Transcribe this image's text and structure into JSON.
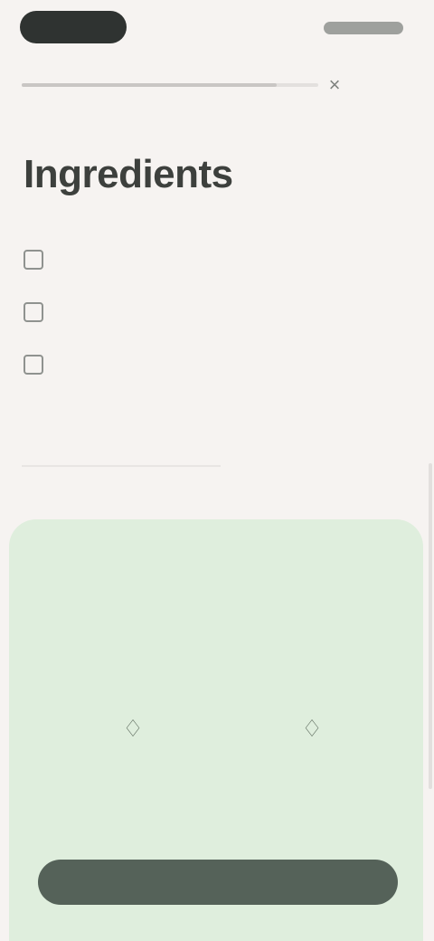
{
  "status_bar": {
    "pill_icon": "camera-pill-icon",
    "status_icons": "status-icons"
  },
  "progress": {
    "value": 0.86
  },
  "header": {
    "close_glyph": "×",
    "close_icon": "close-icon",
    "back_label": "",
    "title": "Ingredients"
  },
  "ingredients": {
    "items": [
      {
        "label": ""
      },
      {
        "label": ""
      },
      {
        "label": ""
      }
    ],
    "more_label": ""
  },
  "promo": {
    "text": "",
    "left_action": {
      "icon": "recipe-icon",
      "glyph": "♢",
      "label": ""
    },
    "right_action": {
      "icon": "cart-icon",
      "glyph": "♢",
      "label": ""
    },
    "footer": ""
  },
  "bottom_bar": {
    "left_label": "",
    "right_label": ""
  },
  "colors": {
    "background": "#f6f3f1",
    "card_green": "#dfeedd",
    "bar_dark": "#556259"
  }
}
